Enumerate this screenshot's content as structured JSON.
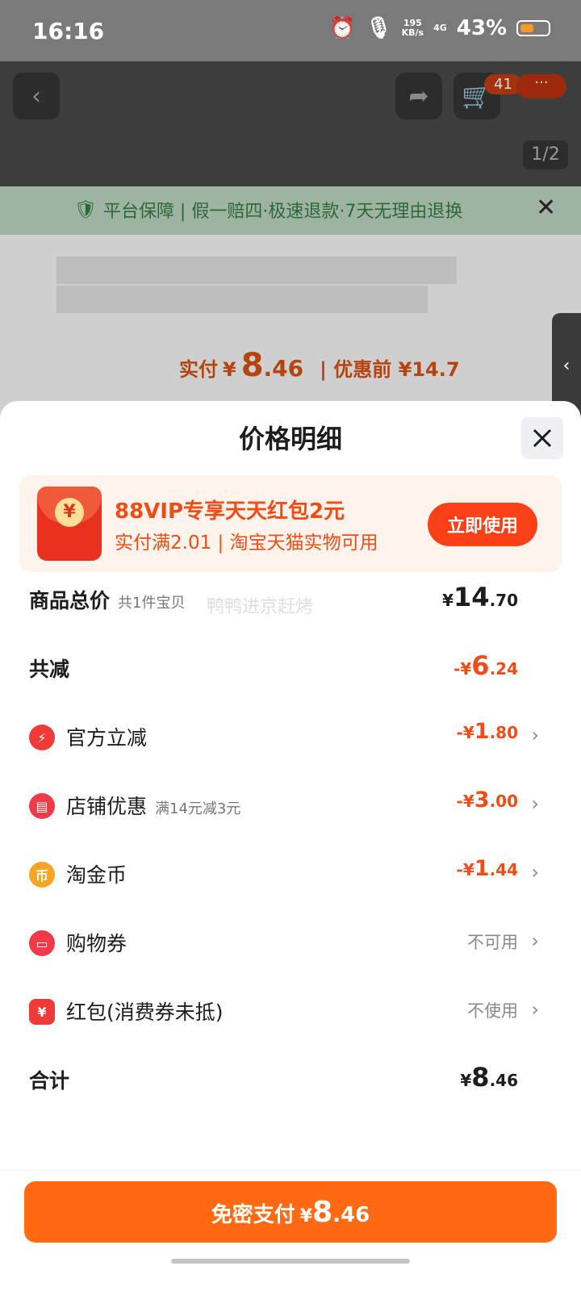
{
  "status_bar": {
    "time": "16:16",
    "net_speed_top": "195",
    "net_speed_bottom": "KB/s",
    "network": "4G",
    "battery": "43%"
  },
  "background": {
    "cart_count": "41",
    "page_indicator": "1/2",
    "guarantee_text": "平台保障 | 假一赔四·极速退款·7天无理由退换",
    "paid_label": "实付",
    "paid_currency": "¥",
    "paid_int": "8",
    "paid_dec": ".46",
    "before_discount": "| 优惠前 ¥14.7"
  },
  "sheet": {
    "title": "价格明细",
    "promo": {
      "icon_symbol": "¥",
      "title": "88VIP专享天天红包2元",
      "subtitle": "实付满2.01 | 淘宝天猫实物可用",
      "button": "立即使用"
    },
    "watermark": "鸭鸭进京赶烤",
    "rows": [
      {
        "label": "商品总价",
        "note": "共1件宝贝",
        "sym": "¥",
        "int": "14",
        "dec": ".70"
      },
      {
        "label": "共减",
        "note": "",
        "sym": "-¥",
        "int": "6",
        "dec": ".24"
      },
      {
        "label": "官方立减",
        "note": "",
        "sym": "-¥",
        "int": "1",
        "dec": ".80",
        "icon": "lightning-icon",
        "icon_color": "#f03a3a"
      },
      {
        "label": "店铺优惠",
        "note": "满14元减3元",
        "sym": "-¥",
        "int": "3",
        "dec": ".00",
        "icon": "store-icon",
        "icon_color": "#f03a4a"
      },
      {
        "label": "淘金币",
        "note": "",
        "sym": "-¥",
        "int": "1",
        "dec": ".44",
        "icon": "coin-icon",
        "icon_color": "#f5a623"
      },
      {
        "label": "购物券",
        "note": "",
        "status": "不可用",
        "icon": "ticket-icon",
        "icon_color": "#f03a4a"
      },
      {
        "label": "红包(消费券未抵)",
        "note": "",
        "status": "不使用",
        "icon": "red-envelope-icon",
        "icon_color": "#f03a3a"
      },
      {
        "label": "合计",
        "note": "",
        "sym": "¥",
        "int": "8",
        "dec": ".46"
      }
    ],
    "pay_button": {
      "text": "免密支付",
      "sym": "¥",
      "int": "8",
      "dec": ".46"
    }
  },
  "colors": {
    "accent": "#ff6a12",
    "discount": "#f04c18"
  }
}
